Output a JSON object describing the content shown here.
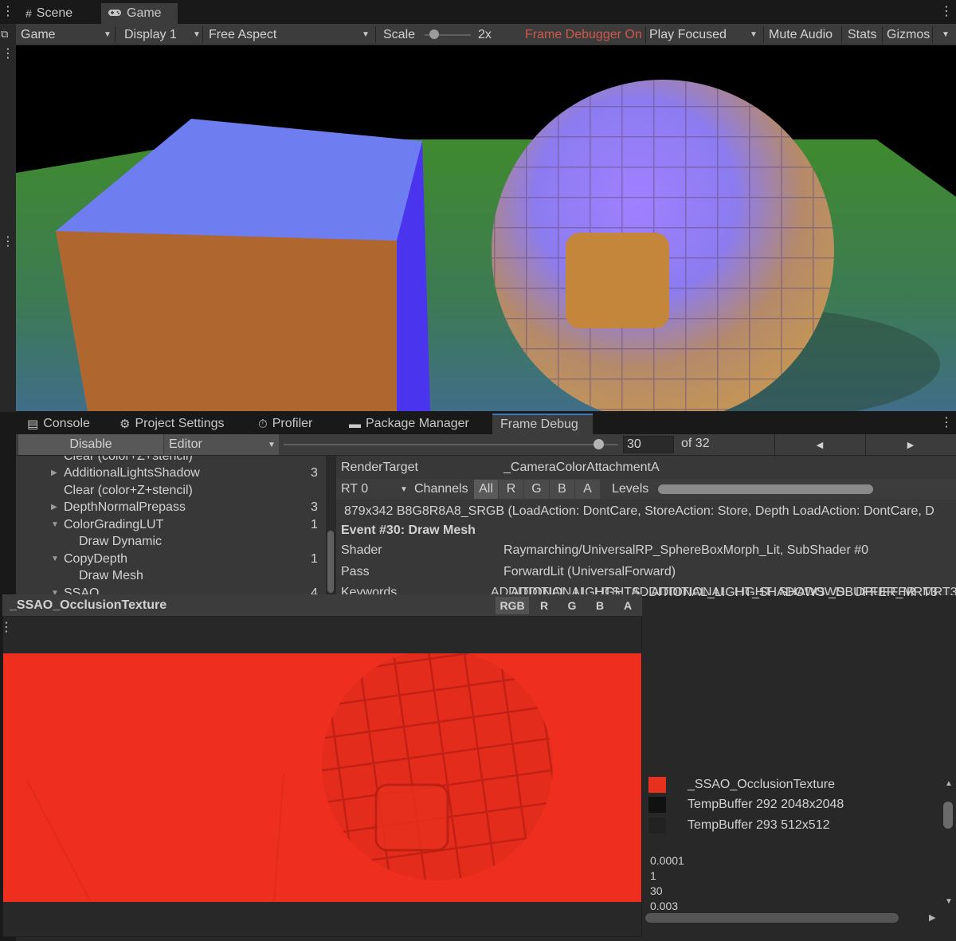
{
  "top_tabs": {
    "scene": "Scene",
    "game": "Game"
  },
  "game_toolbar": {
    "mode": "Game",
    "display": "Display 1",
    "aspect": "Free Aspect",
    "scale_label": "Scale",
    "scale_value": "2x",
    "scale_fraction": 0.0,
    "frame_debugger": "Frame Debugger On",
    "play_mode": "Play Focused",
    "mute_audio": "Mute Audio",
    "stats": "Stats",
    "gizmos": "Gizmos"
  },
  "bottom_tabs": {
    "console": "Console",
    "project_settings": "Project Settings",
    "profiler": "Profiler",
    "package_manager": "Package Manager",
    "frame_debug": "Frame Debug"
  },
  "fd_toolbar": {
    "disable": "Disable",
    "target": "Editor",
    "event_index": "30",
    "event_total": "of 32",
    "slider_fraction": 0.94
  },
  "tree": {
    "items": [
      {
        "label": "Clear (color+Z+stencil)",
        "count": "",
        "expander": "",
        "indent": 1
      },
      {
        "label": "AdditionalLightsShadow",
        "count": "3",
        "expander": "collapsed",
        "indent": 1
      },
      {
        "label": "Clear (color+Z+stencil)",
        "count": "",
        "expander": "",
        "indent": 1
      },
      {
        "label": "DepthNormalPrepass",
        "count": "3",
        "expander": "collapsed",
        "indent": 1
      },
      {
        "label": "ColorGradingLUT",
        "count": "1",
        "expander": "expanded",
        "indent": 1
      },
      {
        "label": "Draw Dynamic",
        "count": "",
        "expander": "",
        "indent": 2
      },
      {
        "label": "CopyDepth",
        "count": "1",
        "expander": "expanded",
        "indent": 1
      },
      {
        "label": "Draw Mesh",
        "count": "",
        "expander": "",
        "indent": 2
      },
      {
        "label": "SSAO",
        "count": "4",
        "expander": "expanded",
        "indent": 1
      }
    ]
  },
  "details": {
    "render_target_label": "RenderTarget",
    "render_target_value": "_CameraColorAttachmentA",
    "rt": "RT 0",
    "channels_label": "Channels",
    "channels": [
      "All",
      "R",
      "G",
      "B",
      "A"
    ],
    "levels_label": "Levels",
    "format_line": "879x342 B8G8R8A8_SRGB (LoadAction: DontCare, StoreAction: Store, Depth LoadAction: DontCare, D",
    "event_title": "Event #30: Draw Mesh",
    "shader_label": "Shader",
    "shader_value": "Raymarching/UniversalRP_SphereBoxMorph_Lit, SubShader #0",
    "pass_label": "Pass",
    "pass_value": "ForwardLit (UniversalForward)",
    "keywords_label": "Keywords",
    "keywords_value": "_ADDITIONAL_LIGHTS _ADDITIONAL_LIGHT_SHADOWS _DBUFFER_MRT3"
  },
  "preview": {
    "title": "_SSAO_OcclusionTexture",
    "channels": [
      "RGB",
      "R",
      "G",
      "B",
      "A"
    ]
  },
  "textures": [
    {
      "label": "_SSAO_OcclusionTexture",
      "thumb_color": "#e8301f"
    },
    {
      "label": "TempBuffer 292 2048x2048",
      "thumb_color": "#111111"
    },
    {
      "label": "TempBuffer 293 512x512",
      "thumb_color": "#222222"
    }
  ],
  "numbers": [
    "0.0001",
    "1",
    "30",
    "0.003"
  ],
  "colors": {
    "frame_debugger_on": "#d0584a",
    "ssao_red": "#ee2f1f",
    "accent": "#3a79bb"
  }
}
